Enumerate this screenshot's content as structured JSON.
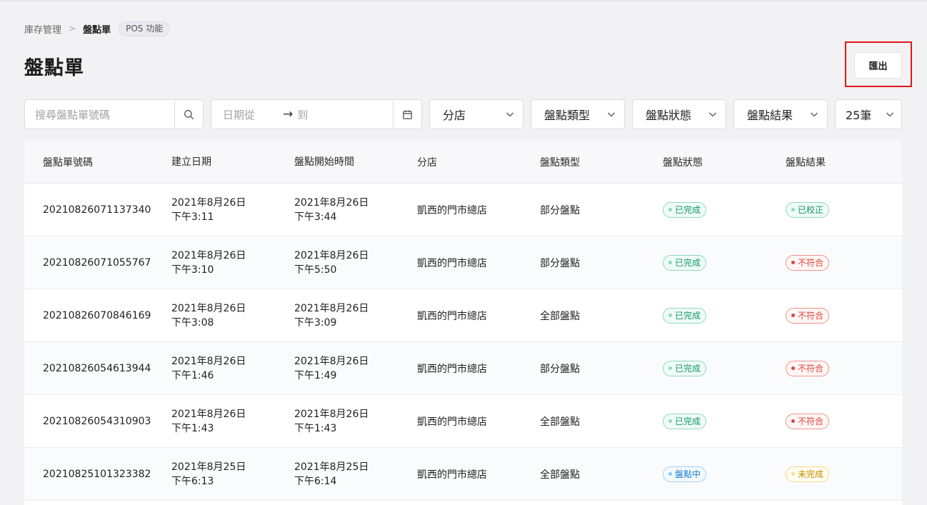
{
  "breadcrumb": {
    "parent": "庫存管理",
    "current": "盤點單",
    "tag": "POS 功能"
  },
  "page": {
    "title": "盤點單"
  },
  "toolbar": {
    "export_label": "匯出"
  },
  "filters": {
    "search_placeholder": "搜尋盤點單號碼",
    "date_from_placeholder": "日期從",
    "date_to_placeholder": "到",
    "store": "分店",
    "count_type": "盤點類型",
    "count_status": "盤點狀態",
    "count_result": "盤點結果",
    "page_size": "25筆"
  },
  "table": {
    "headers": [
      "盤點單號碼",
      "建立日期",
      "盤點開始時間",
      "分店",
      "盤點類型",
      "盤點狀態",
      "盤點結果"
    ],
    "rows": [
      {
        "id": "20210826071137340",
        "created_date": "2021年8月26日",
        "created_time": "下午3:11",
        "start_date": "2021年8月26日",
        "start_time": "下午3:44",
        "store": "凱西的門市總店",
        "type": "部分盤點",
        "status": "已完成",
        "status_color": "green",
        "result": "已校正",
        "result_color": "green"
      },
      {
        "id": "20210826071055767",
        "created_date": "2021年8月26日",
        "created_time": "下午3:10",
        "start_date": "2021年8月26日",
        "start_time": "下午5:50",
        "store": "凱西的門市總店",
        "type": "部分盤點",
        "status": "已完成",
        "status_color": "green",
        "result": "不符合",
        "result_color": "red"
      },
      {
        "id": "20210826070846169",
        "created_date": "2021年8月26日",
        "created_time": "下午3:08",
        "start_date": "2021年8月26日",
        "start_time": "下午3:09",
        "store": "凱西的門市總店",
        "type": "全部盤點",
        "status": "已完成",
        "status_color": "green",
        "result": "不符合",
        "result_color": "red"
      },
      {
        "id": "20210826054613944",
        "created_date": "2021年8月26日",
        "created_time": "下午1:46",
        "start_date": "2021年8月26日",
        "start_time": "下午1:49",
        "store": "凱西的門市總店",
        "type": "部分盤點",
        "status": "已完成",
        "status_color": "green",
        "result": "不符合",
        "result_color": "red"
      },
      {
        "id": "20210826054310903",
        "created_date": "2021年8月26日",
        "created_time": "下午1:43",
        "start_date": "2021年8月26日",
        "start_time": "下午1:43",
        "store": "凱西的門市總店",
        "type": "全部盤點",
        "status": "已完成",
        "status_color": "green",
        "result": "不符合",
        "result_color": "red"
      },
      {
        "id": "20210825101323382",
        "created_date": "2021年8月25日",
        "created_time": "下午6:13",
        "start_date": "2021年8月25日",
        "start_time": "下午6:14",
        "store": "凱西的門市總店",
        "type": "全部盤點",
        "status": "盤點中",
        "status_color": "blue",
        "result": "未完成",
        "result_color": "yellow"
      }
    ]
  },
  "icons": {
    "search": "search-icon",
    "calendar": "calendar-icon",
    "chevron": "chevron-down-icon",
    "arrow": "arrow-right-icon"
  }
}
